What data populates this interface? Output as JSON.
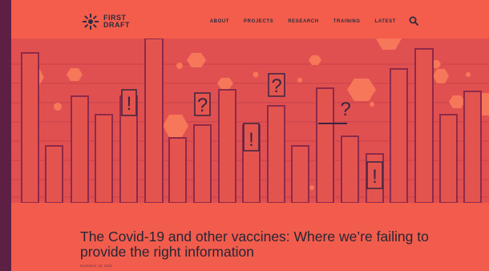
{
  "site": {
    "logo_line1": "FIRST",
    "logo_line2": "DRAFT"
  },
  "nav": {
    "items": [
      "ABOUT",
      "PROJECTS",
      "RESEARCH",
      "TRAINING",
      "LATEST"
    ],
    "search_icon": "search-icon"
  },
  "hero": {
    "marks": [
      "!",
      "?",
      "?",
      "!",
      "?",
      "!"
    ]
  },
  "article": {
    "headline": "The Covid-19 and other vaccines: Where we’re failing to provide the right information",
    "date": "November 19, 2020"
  },
  "colors": {
    "background": "#5e1f44",
    "page": "#f25c4c",
    "hero": "#e05050",
    "ink": "#2c2c3f",
    "hexagon": "#f7775a"
  }
}
